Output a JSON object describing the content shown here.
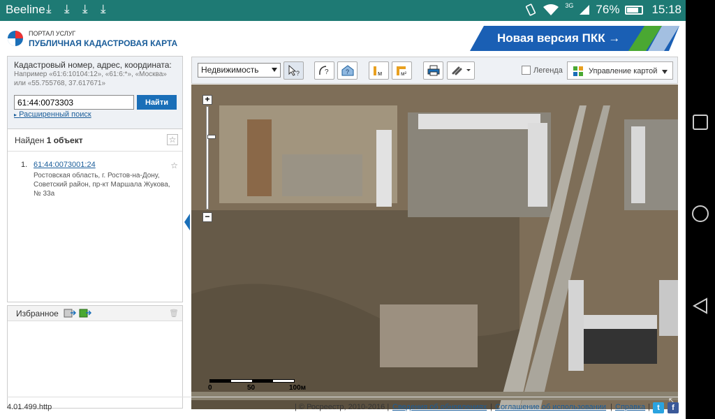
{
  "status_bar": {
    "carrier": "Beeline",
    "network": "3G",
    "battery": "76%",
    "time": "15:18"
  },
  "header": {
    "portal_small": "ПОРТАЛ УСЛУГ",
    "portal_title": "ПУБЛИЧНАЯ КАДАСТРОВАЯ КАРТА",
    "banner": "Новая версия ПКК →"
  },
  "search": {
    "title": "Кадастровый номер, адрес, координата:",
    "hint": "Например «61:6:10104:12», «61:6:*», «Москва» или «55.755768, 37.617671»",
    "value": "61:44:0073303",
    "button": "Найти",
    "advanced": "Расширенный поиск"
  },
  "results": {
    "found_prefix": "Найден",
    "found_count": "1 объект",
    "items": [
      {
        "num": "1.",
        "cad": "61:44:0073001:24",
        "address": "Ростовская область, г. Ростов-на-Дону, Советский район, пр-кт Маршала Жукова, № 33а"
      }
    ]
  },
  "favorites": {
    "title": "Избранное"
  },
  "toolbar": {
    "layer_select": "Недвижимость",
    "legend_label": "Легенда",
    "map_control": "Управление картой"
  },
  "map": {
    "scale_labels": [
      "0",
      "50",
      "100м"
    ]
  },
  "footer": {
    "version": "4.01.499.http",
    "copyright": "| © Росреестр, 2010-2016 |",
    "links": [
      "Сведения об обновлениях",
      "Соглашение об использовании",
      "Справка"
    ]
  },
  "icons": [
    "download-icon",
    "wifi-icon",
    "battery-icon",
    "vibrate-icon",
    "star-icon",
    "trash-icon",
    "twitter-icon",
    "facebook-icon"
  ],
  "colors": {
    "status_bar": "#1e7a74",
    "accent": "#1a6fb8",
    "banner_blue": "#1a5fb4",
    "banner_green": "#4aa832"
  }
}
